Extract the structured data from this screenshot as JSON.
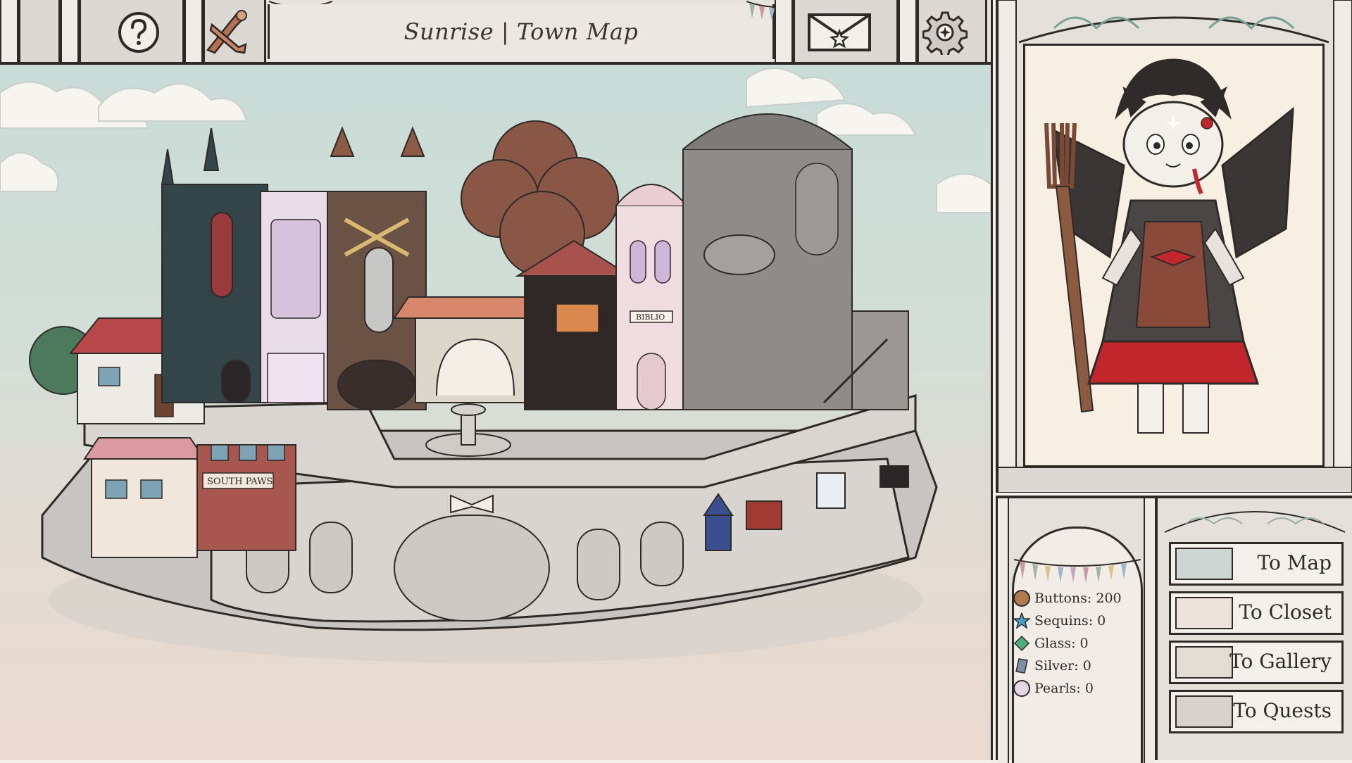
{
  "header": {
    "title": "Sunrise | Town Map",
    "help_icon": "question-mark-icon",
    "horn_icon": "trumpets-icon",
    "mail_icon": "envelope-icon",
    "settings_icon": "gear-icon"
  },
  "map": {
    "shop_signs": [
      "SOUTH PAWS",
      "BIBLIO"
    ]
  },
  "currency": [
    {
      "label": "Buttons:",
      "value": "200",
      "icon": "button-icon",
      "color": "#b07a4c"
    },
    {
      "label": "Sequins:",
      "value": "0",
      "icon": "sequin-star-icon",
      "color": "#4aa0c8"
    },
    {
      "label": "Glass:",
      "value": "0",
      "icon": "glass-gem-icon",
      "color": "#4cae7a"
    },
    {
      "label": "Silver:",
      "value": "0",
      "icon": "silver-icon",
      "color": "#7d8fa3"
    },
    {
      "label": "Pearls:",
      "value": "0",
      "icon": "pearl-icon",
      "color": "#e6d6e6"
    }
  ],
  "nav": [
    {
      "label": "To Map",
      "icon": "map-thumbnail-icon"
    },
    {
      "label": "To Closet",
      "icon": "closet-thumbnail-icon"
    },
    {
      "label": "To Gallery",
      "icon": "gallery-thumbnail-icon"
    },
    {
      "label": "To Quests",
      "icon": "quests-thumbnail-icon"
    }
  ],
  "colors": {
    "ink": "#2e2a28",
    "frame": "#e4e0da",
    "sky": "#c9dcd7",
    "accent_red": "#c2252b"
  }
}
